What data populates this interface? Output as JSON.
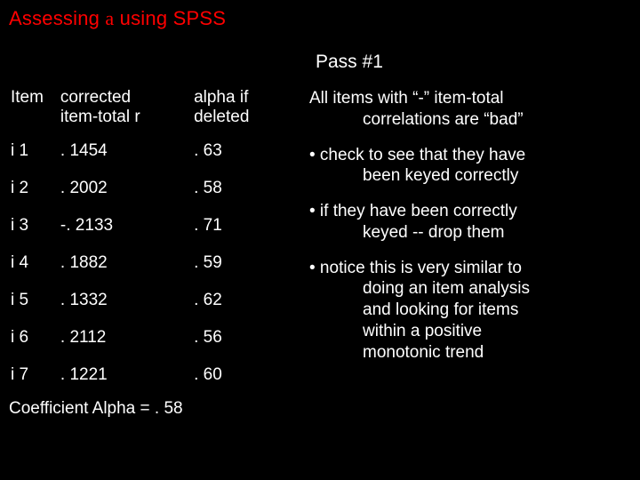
{
  "title_pre": "Assessing ",
  "title_alpha": "a",
  "title_post": "  using SPSS",
  "pass_label": "Pass #1",
  "headers": {
    "item": "Item",
    "corrected_l1": "corrected",
    "corrected_l2": "item-total r",
    "alpha_l1": "alpha if",
    "alpha_l2": "deleted"
  },
  "rows": [
    {
      "item": "i 1",
      "corr": ". 1454",
      "alpha": ". 63"
    },
    {
      "item": "i 2",
      "corr": ". 2002",
      "alpha": ". 58"
    },
    {
      "item": "i 3",
      "corr": "-. 2133",
      "alpha": ". 71"
    },
    {
      "item": "i 4",
      "corr": ". 1882",
      "alpha": ". 59"
    },
    {
      "item": "i 5",
      "corr": ". 1332",
      "alpha": ". 62"
    },
    {
      "item": "i 6",
      "corr": ". 2112",
      "alpha": ". 56"
    },
    {
      "item": "i 7",
      "corr": ". 1221",
      "alpha": ". 60"
    }
  ],
  "coeff_label": "Coefficient Alpha =  . 58",
  "notes": {
    "n1a": "All items with “-” item-total",
    "n1b": "correlations are “bad”",
    "n2a": "• check to see that they have",
    "n2b": "been keyed correctly",
    "n3a": "• if they have been correctly",
    "n3b": "keyed --   drop them",
    "n4a": "• notice this is very similar to",
    "n4b": "doing an item analysis",
    "n4c": "and looking for items",
    "n4d": "within a positive",
    "n4e": "monotonic trend"
  }
}
